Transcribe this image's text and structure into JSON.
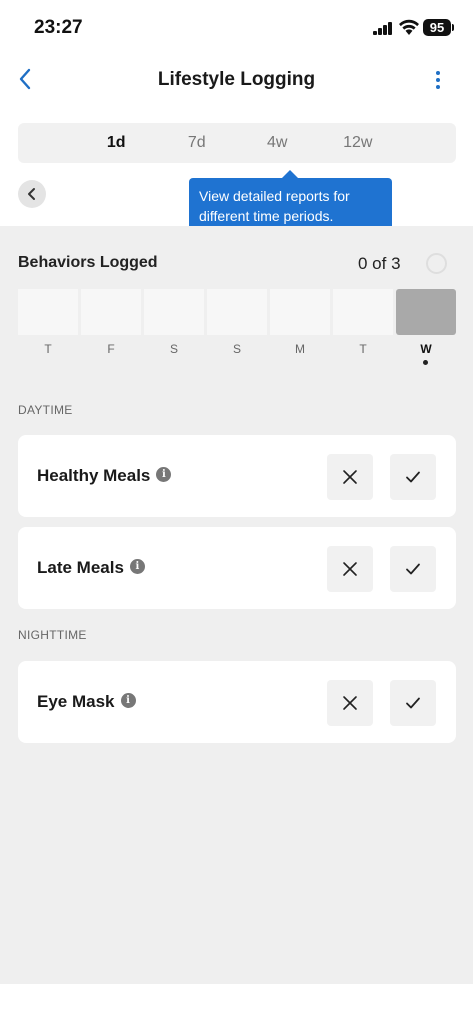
{
  "status_bar": {
    "time": "23:27",
    "battery": "95"
  },
  "nav": {
    "title": "Lifestyle Logging",
    "back_icon": "chevron-left-icon",
    "menu_icon": "more-vertical-icon",
    "accent": "#1f6fc5"
  },
  "periods": [
    "1d",
    "7d",
    "4w",
    "12w"
  ],
  "active_period": "1d",
  "tooltip": {
    "text": "View detailed reports for different time periods.",
    "color": "#1f73d1"
  },
  "behaviors": {
    "title": "Behaviors Logged",
    "count": "0 of 3",
    "days": [
      "T",
      "F",
      "S",
      "S",
      "M",
      "T",
      "W"
    ],
    "today_label": "W"
  },
  "sections": [
    {
      "label": "DAYTIME",
      "items": [
        {
          "label": "Healthy Meals"
        },
        {
          "label": "Late Meals"
        }
      ]
    },
    {
      "label": "NIGHTTIME",
      "items": [
        {
          "label": "Eye Mask"
        }
      ]
    }
  ],
  "info_glyph": "i"
}
